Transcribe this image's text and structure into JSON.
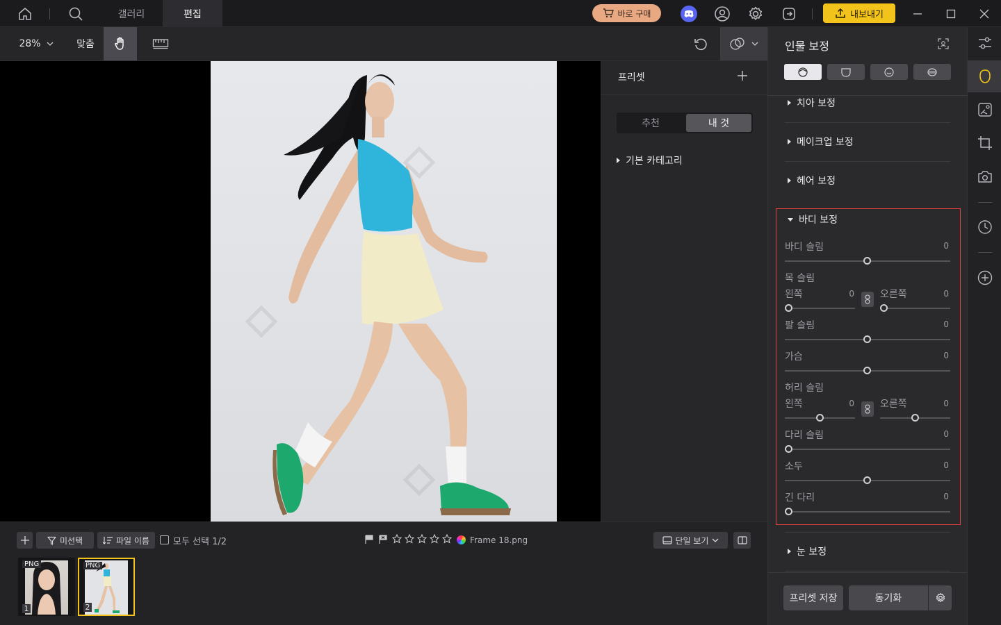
{
  "topbar": {
    "tabs": [
      {
        "label": "갤러리"
      },
      {
        "label": "편집"
      }
    ],
    "buy_label": "바로 구매",
    "export_label": "내보내기",
    "colors": {
      "buy": "#e8a882",
      "export": "#f2c31a"
    }
  },
  "toolbar": {
    "zoom": "28%",
    "fit_label": "맞춤"
  },
  "preset": {
    "title": "프리셋",
    "tabs": [
      "추천",
      "내 것"
    ],
    "active_tab": "내 것",
    "category": "기본 카테고리"
  },
  "panel": {
    "title": "인물 보정",
    "sections": {
      "teeth": "치아 보정",
      "makeup": "메이크업 보정",
      "hair": "헤어 보정",
      "body": "바디 보정",
      "eyes": "눈 보정"
    },
    "sliders": {
      "body_slim": {
        "label": "바디 슬림",
        "value": "0"
      },
      "neck_slim": {
        "label": "목 슬림"
      },
      "neck_left": {
        "label": "왼쪽",
        "value": "0"
      },
      "neck_right": {
        "label": "오른쪽",
        "value": "0"
      },
      "arm_slim": {
        "label": "팔 슬림",
        "value": "0"
      },
      "chest": {
        "label": "가슴",
        "value": "0"
      },
      "waist_slim": {
        "label": "허리 슬림"
      },
      "waist_left": {
        "label": "왼쪽",
        "value": "0"
      },
      "waist_right": {
        "label": "오른쪽",
        "value": "0"
      },
      "leg_slim": {
        "label": "다리 슬림",
        "value": "0"
      },
      "head": {
        "label": "소두",
        "value": "0"
      },
      "long_legs": {
        "label": "긴 다리",
        "value": "0"
      }
    },
    "save_preset": "프리셋 저장",
    "sync": "동기화",
    "highlight_color": "#e0433f"
  },
  "bottom": {
    "unselected": "미선택",
    "file_name": "파일 이름",
    "select_all": "모두 선택 1/2",
    "filename": "Frame 18.png",
    "view_mode": "단일 보기",
    "thumbs": [
      {
        "badge": "PNG",
        "num": "1"
      },
      {
        "badge": "PNG",
        "num": "2"
      }
    ]
  }
}
